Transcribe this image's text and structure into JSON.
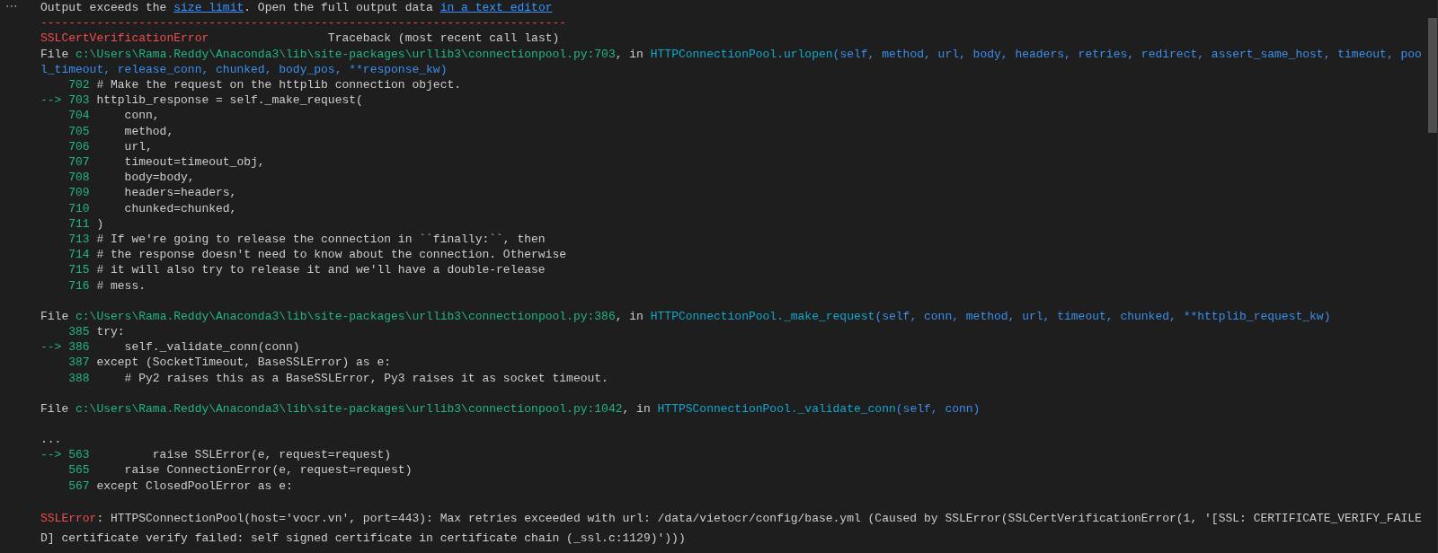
{
  "more_button": {
    "label": "⋯"
  },
  "blocks": [
    {
      "lines": [
        {
          "kind": "text",
          "segments": [
            {
              "kind": "plain",
              "text": "Output exceeds the "
            },
            {
              "kind": "link",
              "text": "size limit"
            },
            {
              "kind": "plain",
              "text": ". Open the full output data "
            },
            {
              "kind": "link",
              "text": "in a text editor"
            }
          ]
        },
        {
          "kind": "text",
          "segments": [
            {
              "kind": "error",
              "text": "---------------------------------------------------------------------------"
            }
          ]
        },
        {
          "kind": "text",
          "segments": [
            {
              "kind": "error",
              "text": "SSLCertVerificationError"
            },
            {
              "kind": "aside",
              "text": "Traceback (most recent call last)"
            }
          ]
        },
        {
          "kind": "text",
          "segments": [
            {
              "kind": "plain",
              "text": "File "
            },
            {
              "kind": "path",
              "text": "c:\\Users\\Rama.Reddy\\Anaconda3\\lib\\site-packages\\urllib3\\connectionpool.py:703"
            },
            {
              "kind": "plain",
              "text": ", in "
            },
            {
              "kind": "func",
              "text": "HTTPConnectionPool.urlopen"
            },
            {
              "kind": "args",
              "text": "(self, method, url, body, headers, retries, redirect, assert_same_host, timeout, poo"
            }
          ]
        },
        {
          "kind": "text",
          "segments": [
            {
              "kind": "args",
              "text": "l_timeout, release_conn, chunked, body_pos, **response_kw)"
            }
          ]
        },
        {
          "kind": "code",
          "number": "702",
          "code": "# Make the request on the httplib connection object."
        },
        {
          "kind": "code",
          "marker": "-->",
          "number": "703",
          "code": "httplib_response = self._make_request("
        },
        {
          "kind": "code",
          "number": "704",
          "code": "    conn,"
        },
        {
          "kind": "code",
          "number": "705",
          "code": "    method,"
        },
        {
          "kind": "code",
          "number": "706",
          "code": "    url,"
        },
        {
          "kind": "code",
          "number": "707",
          "code": "    timeout=timeout_obj,"
        },
        {
          "kind": "code",
          "number": "708",
          "code": "    body=body,"
        },
        {
          "kind": "code",
          "number": "709",
          "code": "    headers=headers,"
        },
        {
          "kind": "code",
          "number": "710",
          "code": "    chunked=chunked,"
        },
        {
          "kind": "code",
          "number": "711",
          "code": ")"
        },
        {
          "kind": "code",
          "number": "713",
          "code": "# If we're going to release the connection in ``finally:``, then"
        },
        {
          "kind": "code",
          "number": "714",
          "code": "# the response doesn't need to know about the connection. Otherwise"
        },
        {
          "kind": "code",
          "number": "715",
          "code": "# it will also try to release it and we'll have a double-release"
        },
        {
          "kind": "code",
          "number": "716",
          "code": "# mess."
        }
      ]
    },
    {
      "lines": [
        {
          "kind": "text",
          "segments": [
            {
              "kind": "plain",
              "text": "File "
            },
            {
              "kind": "path",
              "text": "c:\\Users\\Rama.Reddy\\Anaconda3\\lib\\site-packages\\urllib3\\connectionpool.py:386"
            },
            {
              "kind": "plain",
              "text": ", in "
            },
            {
              "kind": "func",
              "text": "HTTPConnectionPool._make_request"
            },
            {
              "kind": "args",
              "text": "(self, conn, method, url, timeout, chunked, **httplib_request_kw)"
            }
          ]
        },
        {
          "kind": "code",
          "number": "385",
          "code": "try:"
        },
        {
          "kind": "code",
          "marker": "-->",
          "number": "386",
          "code": "    self._validate_conn(conn)"
        },
        {
          "kind": "code",
          "number": "387",
          "code": "except (SocketTimeout, BaseSSLError) as e:"
        },
        {
          "kind": "code",
          "number": "388",
          "code": "    # Py2 raises this as a BaseSSLError, Py3 raises it as socket timeout."
        }
      ]
    },
    {
      "lines": [
        {
          "kind": "text",
          "segments": [
            {
              "kind": "plain",
              "text": "File "
            },
            {
              "kind": "path",
              "text": "c:\\Users\\Rama.Reddy\\Anaconda3\\lib\\site-packages\\urllib3\\connectionpool.py:1042"
            },
            {
              "kind": "plain",
              "text": ", in "
            },
            {
              "kind": "func",
              "text": "HTTPSConnectionPool._validate_conn"
            },
            {
              "kind": "args",
              "text": "(self, conn)"
            }
          ]
        }
      ]
    },
    {
      "lines": [
        {
          "kind": "text",
          "segments": [
            {
              "kind": "plain",
              "text": "..."
            }
          ]
        },
        {
          "kind": "code",
          "marker": "-->",
          "number": "563",
          "code": "        raise SSLError(e, request=request)"
        },
        {
          "kind": "code",
          "number": "565",
          "code": "    raise ConnectionError(e, request=request)"
        },
        {
          "kind": "code",
          "number": "567",
          "code": "except ClosedPoolError as e:"
        }
      ]
    },
    {
      "lines": [
        {
          "kind": "text",
          "segments": [
            {
              "kind": "error",
              "text": "SSLError"
            },
            {
              "kind": "plain",
              "text": ": HTTPSConnectionPool(host='vocr.vn', port=443): Max retries exceeded with url: /data/vietocr/config/base.yml (Caused by SSLError(SSLCertVerificationError(1, '[SSL: CERTIFICATE_VERIFY_FAILE"
            }
          ]
        },
        {
          "kind": "text",
          "segments": [
            {
              "kind": "plain",
              "text": "D] certificate verify failed: self signed certificate in certificate chain (_ssl.c:1129)')))"
            }
          ]
        }
      ]
    }
  ]
}
